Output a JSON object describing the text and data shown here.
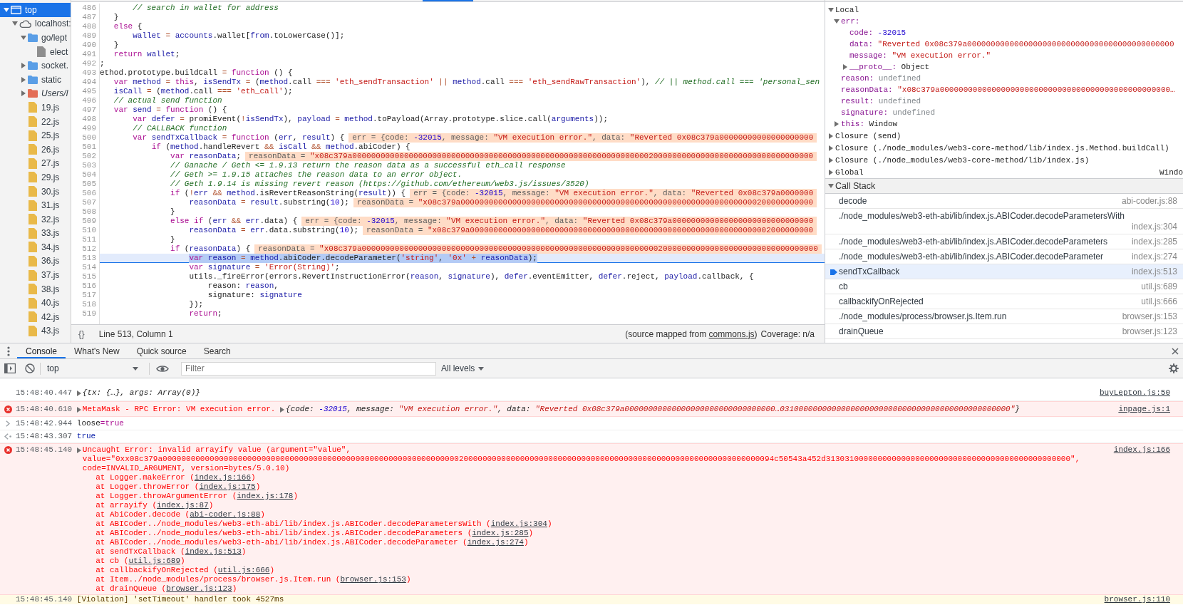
{
  "navigator": {
    "items": [
      {
        "label": "top",
        "kind": "frame",
        "expanded": true,
        "selected": true,
        "children": [
          {
            "label": "localhost:",
            "kind": "domain",
            "expanded": true,
            "selected": false,
            "children": [
              {
                "label": "go/lept",
                "kind": "folder",
                "expanded": true,
                "selected": false,
                "children": [
                  {
                    "label": "elect",
                    "kind": "file",
                    "selected": false
                  }
                ]
              },
              {
                "label": "socket.",
                "kind": "folder",
                "expanded": false,
                "selected": false
              },
              {
                "label": "static",
                "kind": "folder",
                "expanded": false,
                "selected": false
              },
              {
                "label": "Users/l",
                "kind": "filesystem",
                "expanded": false,
                "selected": false
              },
              {
                "label": "19.js",
                "kind": "script",
                "selected": false
              },
              {
                "label": "22.js",
                "kind": "script",
                "selected": false
              },
              {
                "label": "25.js",
                "kind": "script",
                "selected": false
              },
              {
                "label": "26.js",
                "kind": "script",
                "selected": false
              },
              {
                "label": "27.js",
                "kind": "script",
                "selected": false
              },
              {
                "label": "29.js",
                "kind": "script",
                "selected": false
              },
              {
                "label": "30.js",
                "kind": "script",
                "selected": false
              },
              {
                "label": "31.js",
                "kind": "script",
                "selected": false
              },
              {
                "label": "32.js",
                "kind": "script",
                "selected": false
              },
              {
                "label": "33.js",
                "kind": "script",
                "selected": false
              },
              {
                "label": "34.js",
                "kind": "script",
                "selected": false
              },
              {
                "label": "36.js",
                "kind": "script",
                "selected": false
              },
              {
                "label": "37.js",
                "kind": "script",
                "selected": false
              },
              {
                "label": "38.js",
                "kind": "script",
                "selected": false
              },
              {
                "label": "40.js",
                "kind": "script",
                "selected": false
              },
              {
                "label": "42.js",
                "kind": "script",
                "selected": false
              },
              {
                "label": "43.js",
                "kind": "script",
                "selected": false
              }
            ]
          }
        ]
      }
    ]
  },
  "editor": {
    "lines": [
      {
        "number": "486",
        "current": false,
        "tokens": [
          {
            "kind": "comment",
            "text": "       // search in wallet for address"
          }
        ]
      },
      {
        "number": "487",
        "current": false,
        "tokens": [
          {
            "kind": "plain",
            "text": "   }"
          }
        ]
      },
      {
        "number": "488",
        "current": false,
        "tokens": [
          {
            "kind": "keyword",
            "text": "   else"
          },
          {
            "kind": "plain",
            "text": " {"
          }
        ]
      },
      {
        "number": "489",
        "current": false,
        "tokens": [
          {
            "kind": "variable",
            "text": "       wallet"
          },
          {
            "kind": "operator",
            "text": " = "
          },
          {
            "kind": "variable",
            "text": "accounts"
          },
          {
            "kind": "plain",
            "text": ".wallet["
          },
          {
            "kind": "variable",
            "text": "from"
          },
          {
            "kind": "plain",
            "text": ".toLowerCase()];"
          }
        ]
      },
      {
        "number": "490",
        "current": false,
        "tokens": [
          {
            "kind": "plain",
            "text": "   }"
          }
        ]
      },
      {
        "number": "491",
        "current": false,
        "tokens": [
          {
            "kind": "keyword",
            "text": "   return "
          },
          {
            "kind": "variable",
            "text": "wallet"
          },
          {
            "kind": "plain",
            "text": ";"
          }
        ]
      },
      {
        "number": "492",
        "current": false,
        "tokens": [
          {
            "kind": "plain",
            "text": ";"
          }
        ]
      },
      {
        "number": "493",
        "current": false,
        "tokens": [
          {
            "kind": "plain",
            "text": "ethod.prototype.buildCall "
          },
          {
            "kind": "operator",
            "text": "= "
          },
          {
            "kind": "keyword",
            "text": "function"
          },
          {
            "kind": "plain",
            "text": " () {"
          }
        ]
      },
      {
        "number": "494",
        "current": false,
        "tokens": [
          {
            "kind": "keyword",
            "text": "   var "
          },
          {
            "kind": "variable",
            "text": "method"
          },
          {
            "kind": "operator",
            "text": " = "
          },
          {
            "kind": "keyword",
            "text": "this"
          },
          {
            "kind": "plain",
            "text": ", "
          },
          {
            "kind": "variable",
            "text": "isSendTx"
          },
          {
            "kind": "operator",
            "text": " = "
          },
          {
            "kind": "plain",
            "text": "("
          },
          {
            "kind": "variable",
            "text": "method"
          },
          {
            "kind": "plain",
            "text": ".call "
          },
          {
            "kind": "operator",
            "text": "=== "
          },
          {
            "kind": "string",
            "text": "'eth_sendTransaction'"
          },
          {
            "kind": "operator",
            "text": " || "
          },
          {
            "kind": "variable",
            "text": "method"
          },
          {
            "kind": "plain",
            "text": ".call "
          },
          {
            "kind": "operator",
            "text": "=== "
          },
          {
            "kind": "string",
            "text": "'eth_sendRawTransaction'"
          },
          {
            "kind": "plain",
            "text": "), "
          },
          {
            "kind": "comment",
            "text": "// || method.call === 'personal_sen"
          }
        ]
      },
      {
        "number": "495",
        "current": false,
        "tokens": [
          {
            "kind": "variable",
            "text": "   isCall"
          },
          {
            "kind": "operator",
            "text": " = "
          },
          {
            "kind": "plain",
            "text": "("
          },
          {
            "kind": "variable",
            "text": "method"
          },
          {
            "kind": "plain",
            "text": ".call "
          },
          {
            "kind": "operator",
            "text": "=== "
          },
          {
            "kind": "string",
            "text": "'eth_call'"
          },
          {
            "kind": "plain",
            "text": ");"
          }
        ]
      },
      {
        "number": "496",
        "current": false,
        "tokens": [
          {
            "kind": "comment",
            "text": "   // actual send function"
          }
        ]
      },
      {
        "number": "497",
        "current": false,
        "tokens": [
          {
            "kind": "keyword",
            "text": "   var "
          },
          {
            "kind": "variable",
            "text": "send"
          },
          {
            "kind": "operator",
            "text": " = "
          },
          {
            "kind": "keyword",
            "text": "function"
          },
          {
            "kind": "plain",
            "text": " () {"
          }
        ]
      },
      {
        "number": "498",
        "current": false,
        "tokens": [
          {
            "kind": "keyword",
            "text": "       var "
          },
          {
            "kind": "variable",
            "text": "defer"
          },
          {
            "kind": "operator",
            "text": " = "
          },
          {
            "kind": "plain",
            "text": "promiEvent("
          },
          {
            "kind": "operator",
            "text": "!"
          },
          {
            "kind": "variable",
            "text": "isSendTx"
          },
          {
            "kind": "plain",
            "text": "), "
          },
          {
            "kind": "variable",
            "text": "payload"
          },
          {
            "kind": "operator",
            "text": " = "
          },
          {
            "kind": "variable",
            "text": "method"
          },
          {
            "kind": "plain",
            "text": ".toPayload(Array.prototype.slice.call("
          },
          {
            "kind": "variable",
            "text": "arguments"
          },
          {
            "kind": "plain",
            "text": "));"
          }
        ]
      },
      {
        "number": "499",
        "current": false,
        "tokens": [
          {
            "kind": "comment",
            "text": "       // CALLBACK function"
          }
        ]
      },
      {
        "number": "500",
        "current": false,
        "tokens": [
          {
            "kind": "keyword",
            "text": "       var "
          },
          {
            "kind": "variable",
            "text": "sendTxCallback"
          },
          {
            "kind": "operator",
            "text": " = "
          },
          {
            "kind": "keyword",
            "text": "function"
          },
          {
            "kind": "plain",
            "text": " ("
          },
          {
            "kind": "variable",
            "text": "err"
          },
          {
            "kind": "plain",
            "text": ", "
          },
          {
            "kind": "variable",
            "text": "result"
          },
          {
            "kind": "plain",
            "text": ") {"
          }
        ],
        "inline_value": [
          {
            "kind": "plain",
            "text": "err = {code: "
          },
          {
            "kind": "number",
            "text": "-32015"
          },
          {
            "kind": "plain",
            "text": ", message: "
          },
          {
            "kind": "string",
            "text": "\"VM execution error.\""
          },
          {
            "kind": "plain",
            "text": ", data: "
          },
          {
            "kind": "string",
            "text": "\"Reverted 0x08c379a00000000000000000000"
          }
        ]
      },
      {
        "number": "501",
        "current": false,
        "tokens": [
          {
            "kind": "keyword",
            "text": "           if"
          },
          {
            "kind": "plain",
            "text": " ("
          },
          {
            "kind": "variable",
            "text": "method"
          },
          {
            "kind": "plain",
            "text": ".handleRevert "
          },
          {
            "kind": "operator",
            "text": "&& "
          },
          {
            "kind": "variable",
            "text": "isCall"
          },
          {
            "kind": "operator",
            "text": " && "
          },
          {
            "kind": "variable",
            "text": "method"
          },
          {
            "kind": "plain",
            "text": ".abiCoder) {"
          }
        ]
      },
      {
        "number": "502",
        "current": false,
        "tokens": [
          {
            "kind": "keyword",
            "text": "               var "
          },
          {
            "kind": "variable",
            "text": "reasonData"
          },
          {
            "kind": "plain",
            "text": ";"
          }
        ],
        "inline_value": [
          {
            "kind": "plain",
            "text": "reasonData = "
          },
          {
            "kind": "string",
            "text": "\"x08c379a00000000000000000000000000000000000000000000000000000000000000020000000000000000000000000000000000"
          }
        ]
      },
      {
        "number": "503",
        "current": false,
        "tokens": [
          {
            "kind": "comment",
            "text": "               // Ganache / Geth <= 1.9.13 return the reason data as a successful eth_call response"
          }
        ]
      },
      {
        "number": "504",
        "current": false,
        "tokens": [
          {
            "kind": "comment",
            "text": "               // Geth >= 1.9.15 attaches the reason data to an error object."
          }
        ]
      },
      {
        "number": "505",
        "current": false,
        "tokens": [
          {
            "kind": "comment",
            "text": "               // Geth 1.9.14 is missing revert reason (https://github.com/ethereum/web3.js/issues/3520)"
          }
        ]
      },
      {
        "number": "506",
        "current": false,
        "tokens": [
          {
            "kind": "keyword",
            "text": "               if"
          },
          {
            "kind": "plain",
            "text": " ("
          },
          {
            "kind": "operator",
            "text": "!"
          },
          {
            "kind": "variable",
            "text": "err"
          },
          {
            "kind": "operator",
            "text": " && "
          },
          {
            "kind": "variable",
            "text": "method"
          },
          {
            "kind": "plain",
            "text": ".isRevertReasonString("
          },
          {
            "kind": "variable",
            "text": "result"
          },
          {
            "kind": "plain",
            "text": ")) {"
          }
        ],
        "inline_value": [
          {
            "kind": "plain",
            "text": "err = {code: "
          },
          {
            "kind": "number",
            "text": "-32015"
          },
          {
            "kind": "plain",
            "text": ", message: "
          },
          {
            "kind": "string",
            "text": "\"VM execution error.\""
          },
          {
            "kind": "plain",
            "text": ", data: "
          },
          {
            "kind": "string",
            "text": "\"Reverted 0x08c379a0000000"
          }
        ]
      },
      {
        "number": "507",
        "current": false,
        "tokens": [
          {
            "kind": "variable",
            "text": "                   reasonData"
          },
          {
            "kind": "operator",
            "text": " = "
          },
          {
            "kind": "variable",
            "text": "result"
          },
          {
            "kind": "plain",
            "text": ".substring("
          },
          {
            "kind": "number",
            "text": "10"
          },
          {
            "kind": "plain",
            "text": ");"
          }
        ],
        "inline_value": [
          {
            "kind": "plain",
            "text": "reasonData = "
          },
          {
            "kind": "string",
            "text": "\"x08c379a000000000000000000000000000000000000000000000000000000000000000200000000000"
          }
        ]
      },
      {
        "number": "508",
        "current": false,
        "tokens": [
          {
            "kind": "plain",
            "text": "               }"
          }
        ]
      },
      {
        "number": "509",
        "current": false,
        "tokens": [
          {
            "kind": "keyword",
            "text": "               else if"
          },
          {
            "kind": "plain",
            "text": " ("
          },
          {
            "kind": "variable",
            "text": "err"
          },
          {
            "kind": "operator",
            "text": " && "
          },
          {
            "kind": "variable",
            "text": "err"
          },
          {
            "kind": "plain",
            "text": ".data) {"
          }
        ],
        "inline_value": [
          {
            "kind": "plain",
            "text": "err = {code: "
          },
          {
            "kind": "number",
            "text": "-32015"
          },
          {
            "kind": "plain",
            "text": ", message: "
          },
          {
            "kind": "string",
            "text": "\"VM execution error.\""
          },
          {
            "kind": "plain",
            "text": ", data: "
          },
          {
            "kind": "string",
            "text": "\"Reverted 0x08c379a000000000000000000000000000000"
          }
        ]
      },
      {
        "number": "510",
        "current": false,
        "tokens": [
          {
            "kind": "variable",
            "text": "                   reasonData"
          },
          {
            "kind": "operator",
            "text": " = "
          },
          {
            "kind": "variable",
            "text": "err"
          },
          {
            "kind": "plain",
            "text": ".data.substring("
          },
          {
            "kind": "number",
            "text": "10"
          },
          {
            "kind": "plain",
            "text": ");"
          }
        ],
        "inline_value": [
          {
            "kind": "plain",
            "text": "reasonData = "
          },
          {
            "kind": "string",
            "text": "\"x08c379a0000000000000000000000000000000000000000000000000000000000000002000000000"
          }
        ]
      },
      {
        "number": "511",
        "current": false,
        "tokens": [
          {
            "kind": "plain",
            "text": "               }"
          }
        ]
      },
      {
        "number": "512",
        "current": false,
        "tokens": [
          {
            "kind": "keyword",
            "text": "               if"
          },
          {
            "kind": "plain",
            "text": " ("
          },
          {
            "kind": "variable",
            "text": "reasonData"
          },
          {
            "kind": "plain",
            "text": ") {"
          }
        ],
        "inline_value": [
          {
            "kind": "plain",
            "text": "reasonData = "
          },
          {
            "kind": "string",
            "text": "\"x08c379a0000000000000000000000000000000000000000000000000000000000000002000000000000000000000000000000000"
          }
        ]
      },
      {
        "number": "513",
        "current": true,
        "tokens": [
          {
            "kind": "keyword",
            "text": "                   var "
          },
          {
            "kind": "variable",
            "text": "reason"
          },
          {
            "kind": "operator",
            "text": " = "
          },
          {
            "kind": "variable",
            "text": "method"
          },
          {
            "kind": "plain",
            "text": ".abiCoder.decodeParameter("
          },
          {
            "kind": "string",
            "text": "'string'"
          },
          {
            "kind": "plain",
            "text": ", "
          },
          {
            "kind": "string",
            "text": "'0x'"
          },
          {
            "kind": "operator",
            "text": " + "
          },
          {
            "kind": "variable",
            "text": "reasonData"
          },
          {
            "kind": "plain",
            "text": ");"
          }
        ]
      },
      {
        "number": "514",
        "current": false,
        "tokens": [
          {
            "kind": "keyword",
            "text": "                   var "
          },
          {
            "kind": "variable",
            "text": "signature"
          },
          {
            "kind": "operator",
            "text": " = "
          },
          {
            "kind": "string",
            "text": "'Error(String)'"
          },
          {
            "kind": "plain",
            "text": ";"
          }
        ]
      },
      {
        "number": "515",
        "current": false,
        "tokens": [
          {
            "kind": "plain",
            "text": "                   utils._fireError(errors.RevertInstructionError("
          },
          {
            "kind": "variable",
            "text": "reason"
          },
          {
            "kind": "plain",
            "text": ", "
          },
          {
            "kind": "variable",
            "text": "signature"
          },
          {
            "kind": "plain",
            "text": "), "
          },
          {
            "kind": "variable",
            "text": "defer"
          },
          {
            "kind": "plain",
            "text": ".eventEmitter, "
          },
          {
            "kind": "variable",
            "text": "defer"
          },
          {
            "kind": "plain",
            "text": ".reject, "
          },
          {
            "kind": "variable",
            "text": "payload"
          },
          {
            "kind": "plain",
            "text": ".callback, {"
          }
        ]
      },
      {
        "number": "516",
        "current": false,
        "tokens": [
          {
            "kind": "plain",
            "text": "                       reason: "
          },
          {
            "kind": "variable",
            "text": "reason"
          },
          {
            "kind": "plain",
            "text": ","
          }
        ]
      },
      {
        "number": "517",
        "current": false,
        "tokens": [
          {
            "kind": "plain",
            "text": "                       signature: "
          },
          {
            "kind": "variable",
            "text": "signature"
          }
        ]
      },
      {
        "number": "518",
        "current": false,
        "tokens": [
          {
            "kind": "plain",
            "text": "                   });"
          }
        ]
      },
      {
        "number": "519",
        "current": false,
        "tokens": [
          {
            "kind": "keyword",
            "text": "                   return"
          },
          {
            "kind": "plain",
            "text": ";"
          }
        ]
      }
    ],
    "status_bar": {
      "format_button": "{}",
      "position": "Line 513, Column 1",
      "source_map": {
        "before": "(source mapped from ",
        "link": "commons.js",
        "after": ")"
      },
      "coverage": "Coverage: n/a"
    }
  },
  "scope": {
    "sections": [
      {
        "label": "Local",
        "expanded": true,
        "children": [
          {
            "label": "err:",
            "expanded": true,
            "children": [
              {
                "label": "code:",
                "value": "-32015",
                "kind": "number"
              },
              {
                "label": "data:",
                "value": "\"Reverted 0x08c379a00000000000000000000000000000000000000000000",
                "kind": "string"
              },
              {
                "label": "message:",
                "value": "\"VM execution error.\"",
                "kind": "string"
              },
              {
                "label": "__proto__:",
                "value": "Object",
                "kind": "object",
                "expanded": false
              }
            ]
          },
          {
            "label": "reason:",
            "value": "undefined",
            "kind": "undefined"
          },
          {
            "label": "reasonData:",
            "value": "\"x08c379a0000000000000000000000000000000000000000000000000…",
            "kind": "string"
          },
          {
            "label": "result:",
            "value": "undefined",
            "kind": "undefined"
          },
          {
            "label": "signature:",
            "value": "undefined",
            "kind": "undefined"
          },
          {
            "label": "this:",
            "value": "Window",
            "kind": "object",
            "expanded": false
          }
        ]
      },
      {
        "label": "Closure (send)",
        "expanded": false
      },
      {
        "label": "Closure (./node_modules/web3-core-method/lib/index.js.Method.buildCall)",
        "expanded": false
      },
      {
        "label": "Closure (./node_modules/web3-core-method/lib/index.js)",
        "expanded": false
      },
      {
        "label": "Global",
        "expanded": false,
        "value": "Windo"
      }
    ]
  },
  "call_stack": {
    "title": "Call Stack",
    "expanded": true,
    "frames": [
      {
        "function": "decode",
        "location": "abi-coder.js:88",
        "selected": false
      },
      {
        "function": "./node_modules/web3-eth-abi/lib/index.js.ABICoder.decodeParametersWith",
        "location": "index.js:304",
        "selected": false
      },
      {
        "function": "./node_modules/web3-eth-abi/lib/index.js.ABICoder.decodeParameters",
        "location": "index.js:285",
        "selected": false
      },
      {
        "function": "./node_modules/web3-eth-abi/lib/index.js.ABICoder.decodeParameter",
        "location": "index.js:274",
        "selected": false
      },
      {
        "function": "sendTxCallback",
        "location": "index.js:513",
        "selected": true
      },
      {
        "function": "cb",
        "location": "util.js:689",
        "selected": false
      },
      {
        "function": "callbackifyOnRejected",
        "location": "util.js:666",
        "selected": false
      },
      {
        "function": "./node_modules/process/browser.js.Item.run",
        "location": "browser.js:153",
        "selected": false
      },
      {
        "function": "drainQueue",
        "location": "browser.js:123",
        "selected": false
      }
    ]
  },
  "drawer": {
    "tabs": [
      {
        "label": "Console",
        "selected": true
      },
      {
        "label": "What's New",
        "selected": false
      },
      {
        "label": "Quick source",
        "selected": false
      },
      {
        "label": "Search",
        "selected": false
      }
    ]
  },
  "console": {
    "context": "top",
    "filter": {
      "placeholder": "Filter"
    },
    "levels": "All levels",
    "messages": [
      {
        "kind": "log",
        "timestamp": "15:48:40.447",
        "source": "buyLepton.js:50",
        "parts": [
          {
            "kind": "object",
            "expanded": false,
            "tokens": [
              {
                "kind": "plain",
                "text": "{tx: {…}, args: Array(0)}"
              }
            ]
          }
        ]
      },
      {
        "kind": "error",
        "timestamp": "15:48:40.610",
        "source": "inpage.js:1",
        "parts": [
          {
            "kind": "text",
            "expanded": false,
            "tokens": [
              {
                "kind": "plain",
                "text": "MetaMask - RPC Error: VM execution error."
              }
            ]
          },
          {
            "kind": "object",
            "expanded": false,
            "tokens": [
              {
                "kind": "plain",
                "text": "{code: "
              },
              {
                "kind": "number",
                "text": "-32015"
              },
              {
                "kind": "plain",
                "text": ", message: "
              },
              {
                "kind": "string",
                "text": "\"VM execution error.\""
              },
              {
                "kind": "plain",
                "text": ", data: "
              },
              {
                "kind": "string",
                "text": "\"Reverted 0x08c379a00000000000000000000000000000000…0310000000000000000000000000000000000000000000000\""
              },
              {
                "kind": "plain",
                "text": "}"
              }
            ]
          }
        ]
      },
      {
        "kind": "input",
        "timestamp": "15:48:42.944",
        "parts": [
          {
            "kind": "code",
            "tokens": [
              {
                "kind": "plain",
                "text": "loose"
              },
              {
                "kind": "keyword",
                "text": "=true"
              }
            ]
          }
        ]
      },
      {
        "kind": "result",
        "timestamp": "15:48:43.307",
        "parts": [
          {
            "kind": "value",
            "tokens": [
              {
                "kind": "boolean",
                "text": "true"
              }
            ]
          }
        ]
      },
      {
        "kind": "error",
        "timestamp": "15:48:45.140",
        "source": "index.js:166",
        "parts": [
          {
            "kind": "text",
            "expanded": false,
            "tokens": [
              {
                "kind": "plain",
                "text": "Uncaught Error: invalid arrayify value (argument=\"value\", value=\"0xx08c379a0000000000000000000000000000000000000000000000000000000000000002000000000000000000000000000000000000000000000000000000000000000094c50543a452d3130310000000000000000000000000000000000000000000000\", code=INVALID_ARGUMENT, version=bytes/5.0.10)"
              }
            ]
          }
        ],
        "stack": [
          {
            "before": "at Logger.makeError (",
            "link": "index.js:166",
            "after": ")"
          },
          {
            "before": "at Logger.throwError (",
            "link": "index.js:175",
            "after": ")"
          },
          {
            "before": "at Logger.throwArgumentError (",
            "link": "index.js:178",
            "after": ")"
          },
          {
            "before": "at arrayify (",
            "link": "index.js:87",
            "after": ")"
          },
          {
            "before": "at AbiCoder.decode (",
            "link": "abi-coder.js:88",
            "after": ")"
          },
          {
            "before": "at ABICoder../node_modules/web3-eth-abi/lib/index.js.ABICoder.decodeParametersWith (",
            "link": "index.js:304",
            "after": ")"
          },
          {
            "before": "at ABICoder../node_modules/web3-eth-abi/lib/index.js.ABICoder.decodeParameters (",
            "link": "index.js:285",
            "after": ")"
          },
          {
            "before": "at ABICoder../node_modules/web3-eth-abi/lib/index.js.ABICoder.decodeParameter (",
            "link": "index.js:274",
            "after": ")"
          },
          {
            "before": "at sendTxCallback (",
            "link": "index.js:513",
            "after": ")"
          },
          {
            "before": "at cb (",
            "link": "util.js:689",
            "after": ")"
          },
          {
            "before": "at callbackifyOnRejected (",
            "link": "util.js:666",
            "after": ")"
          },
          {
            "before": "at Item../node_modules/process/browser.js.Item.run (",
            "link": "browser.js:153",
            "after": ")"
          },
          {
            "before": "at drainQueue (",
            "link": "browser.js:123",
            "after": ")"
          }
        ]
      },
      {
        "kind": "warning",
        "timestamp": "15:48:45.140",
        "source": "browser.js:110",
        "parts": [
          {
            "kind": "text",
            "tokens": [
              {
                "kind": "plain",
                "text": "[Violation] 'setTimeout' handler took 4527ms"
              }
            ]
          }
        ]
      }
    ]
  }
}
